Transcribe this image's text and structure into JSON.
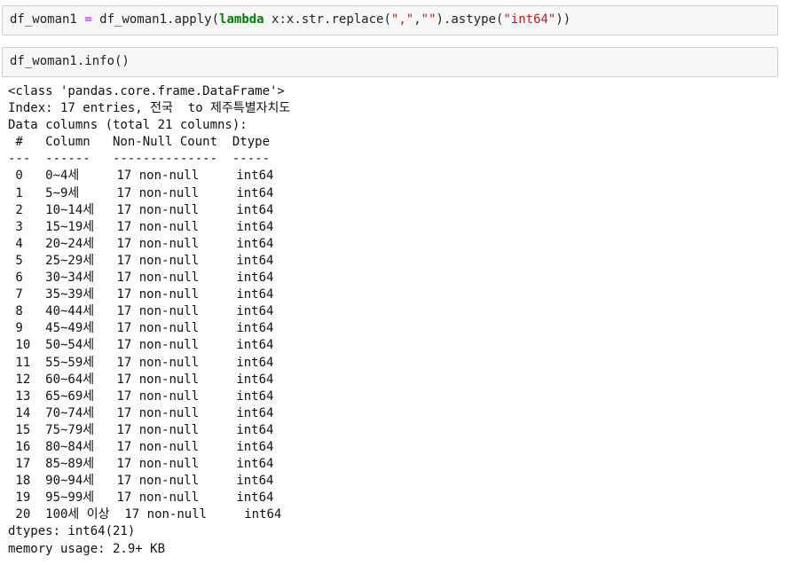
{
  "cells": [
    {
      "code_parts": [
        "df_woman1 ",
        "=",
        " df_woman1.apply(",
        "lambda",
        " x:x.str.replace(",
        "\",\"",
        ",",
        "\"\"",
        ").astype(",
        "\"int64\"",
        "))"
      ]
    },
    {
      "code": "df_woman1.info()"
    }
  ],
  "output_lines": [
    "<class 'pandas.core.frame.DataFrame'>",
    "Index: 17 entries, 전국  to 제주특별자치도",
    "Data columns (total 21 columns):",
    " #   Column   Non-Null Count  Dtype",
    "---  ------   --------------  -----",
    " 0   0~4세     17 non-null     int64",
    " 1   5~9세     17 non-null     int64",
    " 2   10~14세   17 non-null     int64",
    " 3   15~19세   17 non-null     int64",
    " 4   20~24세   17 non-null     int64",
    " 5   25~29세   17 non-null     int64",
    " 6   30~34세   17 non-null     int64",
    " 7   35~39세   17 non-null     int64",
    " 8   40~44세   17 non-null     int64",
    " 9   45~49세   17 non-null     int64",
    " 10  50~54세   17 non-null     int64",
    " 11  55~59세   17 non-null     int64",
    " 12  60~64세   17 non-null     int64",
    " 13  65~69세   17 non-null     int64",
    " 14  70~74세   17 non-null     int64",
    " 15  75~79세   17 non-null     int64",
    " 16  80~84세   17 non-null     int64",
    " 17  85~89세   17 non-null     int64",
    " 18  90~94세   17 non-null     int64",
    " 19  95~99세   17 non-null     int64",
    " 20  100세 이상  17 non-null     int64",
    "dtypes: int64(21)",
    "memory usage: 2.9+ KB"
  ],
  "colors": {
    "cell_background": "#f7f7f7",
    "cell_border": "#cfcfcf",
    "keyword": "#008000",
    "string": "#ba2121",
    "operator": "#aa22ff"
  }
}
